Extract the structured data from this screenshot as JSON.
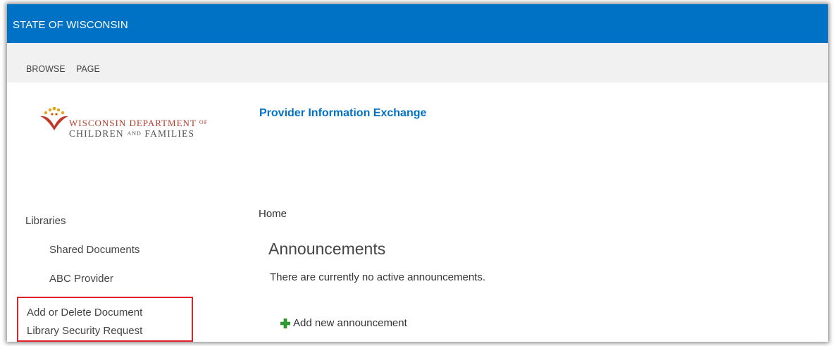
{
  "suitebar": {
    "title": "STATE OF WISCONSIN",
    "bg_color": "#0072c6"
  },
  "ribbon": {
    "tabs": [
      {
        "label": "BROWSE"
      },
      {
        "label": "PAGE"
      }
    ]
  },
  "logo": {
    "line1": "WISCONSIN DEPARTMENT",
    "line1_of": "OF",
    "line2_a": "CHILDREN",
    "line2_and": "AND",
    "line2_b": "FAMILIES"
  },
  "site": {
    "title": "Provider Information Exchange"
  },
  "quick_launch": {
    "heading": "Libraries",
    "items": [
      {
        "label": "Shared Documents"
      },
      {
        "label": "ABC Provider"
      }
    ],
    "highlighted_item": {
      "line1": "Add or Delete Document",
      "line2": "Library Security Request"
    }
  },
  "breadcrumb": "Home",
  "announcements": {
    "title": "Announcements",
    "empty_message": "There are currently no active announcements.",
    "add_new_label": "Add new announcement",
    "add_icon": "plus-icon"
  },
  "colors": {
    "accent": "#0072c6",
    "highlight_border": "#e0212b",
    "add_icon": "#2e9e2e"
  }
}
